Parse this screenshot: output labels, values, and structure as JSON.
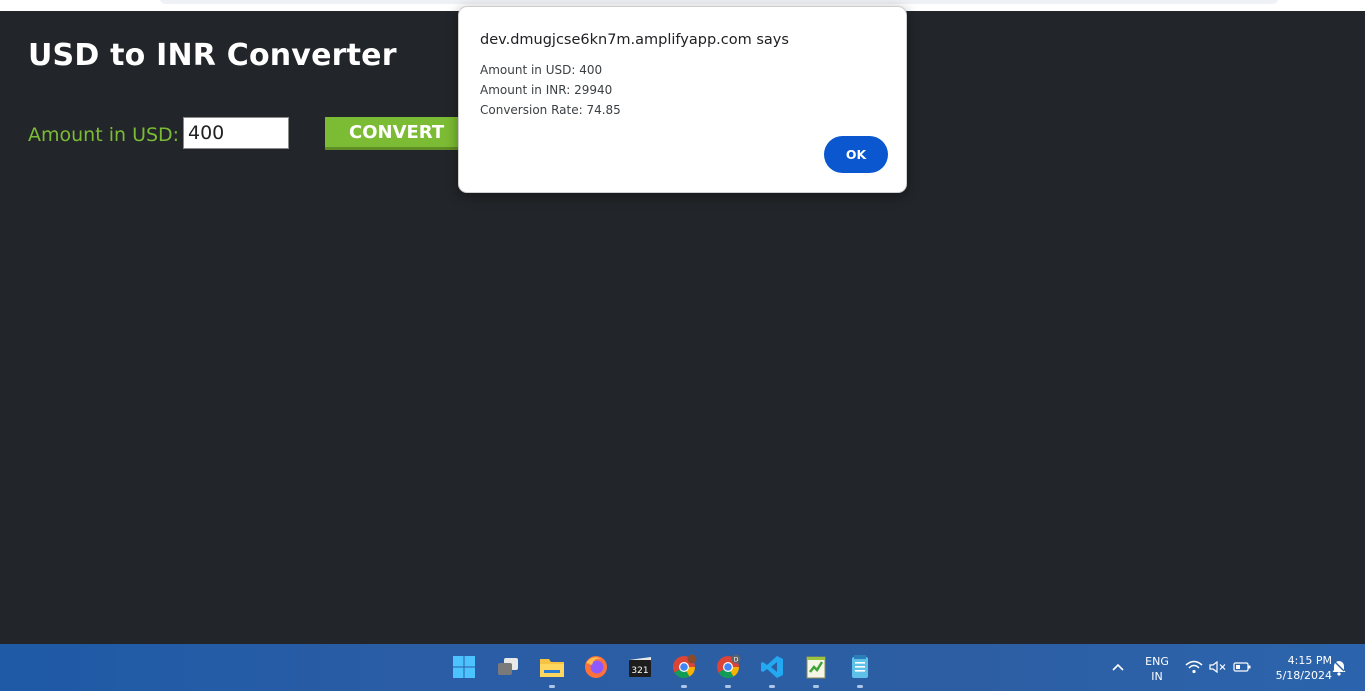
{
  "page": {
    "title": "USD to INR Converter",
    "amount_label": "Amount in USD:",
    "amount_value": "400",
    "convert_label": "CONVERT"
  },
  "dialog": {
    "title": "dev.dmugjcse6kn7m.amplifyapp.com says",
    "lines": [
      "Amount in USD: 400",
      "Amount in INR: 29940",
      "Conversion Rate: 74.85"
    ],
    "ok_label": "OK"
  },
  "taskbar": {
    "apps": [
      "windows-start-icon",
      "task-view-icon",
      "file-explorer-icon",
      "firefox-icon",
      "media-player-icon",
      "chrome-icon",
      "chrome-profile-icon",
      "vscode-icon",
      "notepadpp-icon",
      "notepad-icon"
    ],
    "language": [
      "ENG",
      "IN"
    ],
    "time": "4:15 PM",
    "date": "5/18/2024"
  },
  "colors": {
    "background": "#222529",
    "accent_green": "#7cbb34",
    "ok_blue": "#0b57d0",
    "taskbar": "#2a5da5"
  }
}
